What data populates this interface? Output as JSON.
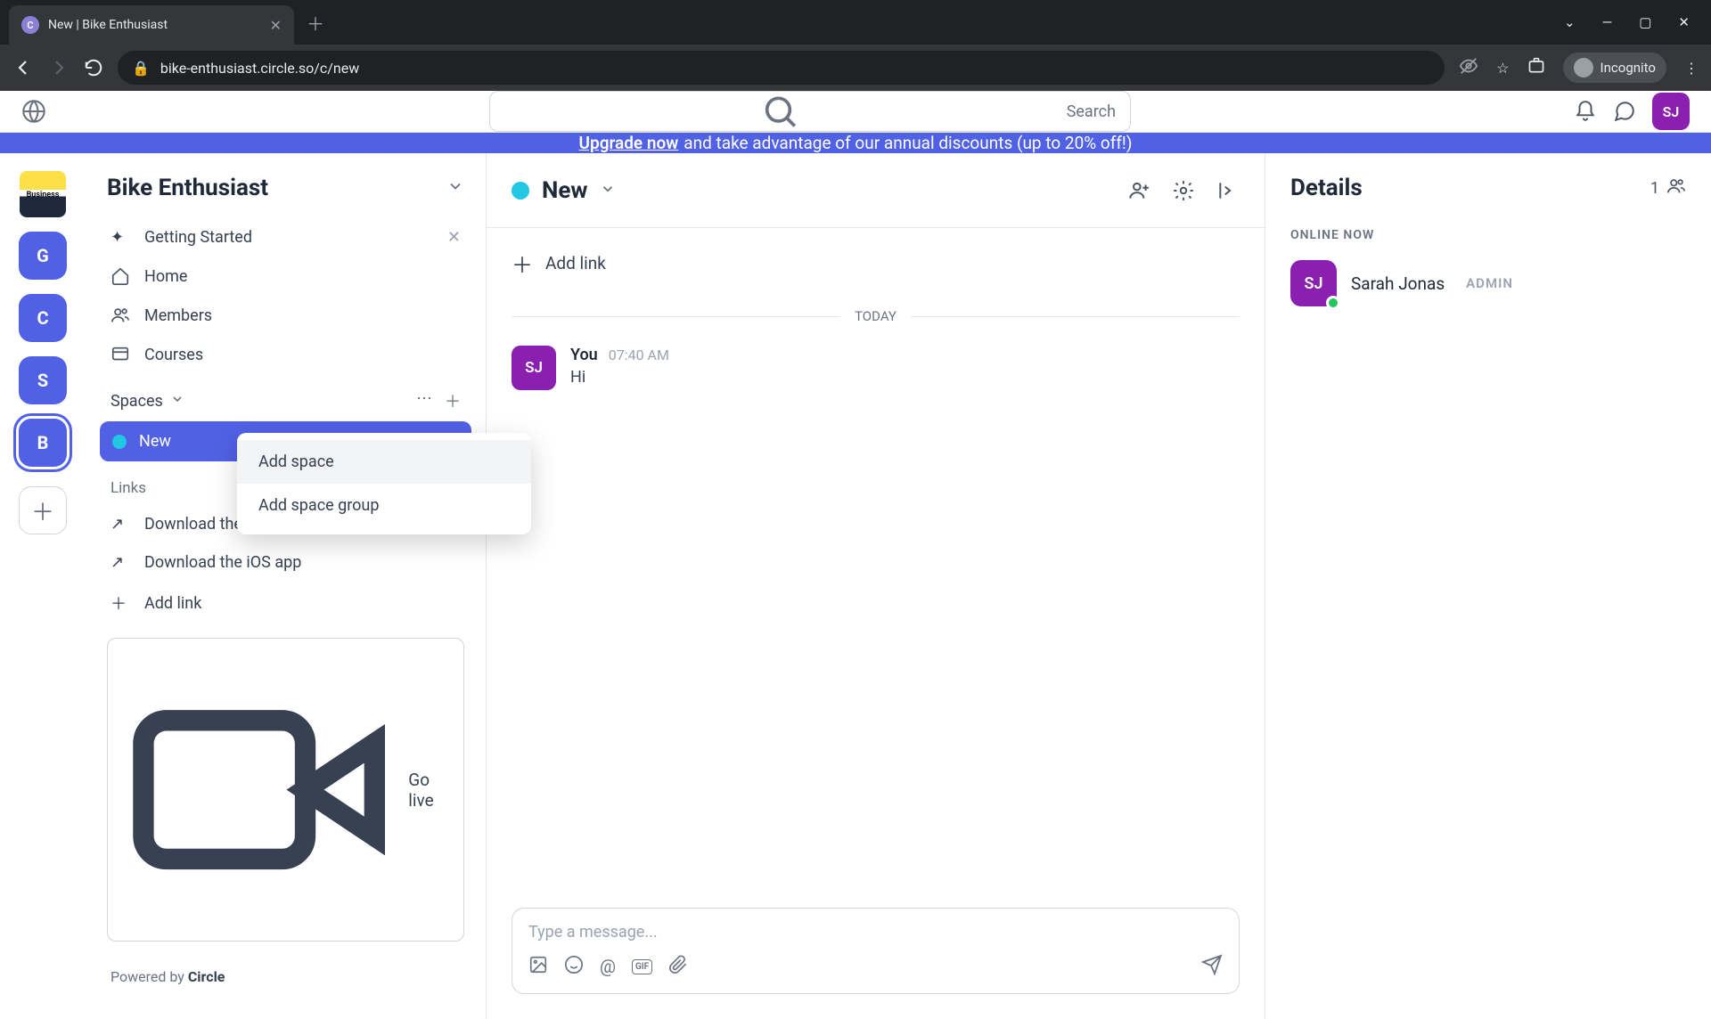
{
  "browser": {
    "tab_title": "New | Bike Enthusiast",
    "url": "bike-enthusiast.circle.so/c/new",
    "incognito_label": "Incognito"
  },
  "topbar": {
    "search_placeholder": "Search",
    "avatar_initials": "SJ"
  },
  "banner": {
    "link_text": "Upgrade now",
    "rest_text": " and take advantage of our annual discounts (up to 20% off!)"
  },
  "rail": {
    "logo_text": "Business",
    "items": [
      "G",
      "C",
      "S",
      "B"
    ],
    "active_index": 3
  },
  "sidebar": {
    "community_name": "Bike Enthusiast",
    "nav": {
      "getting_started": "Getting Started",
      "home": "Home",
      "members": "Members",
      "courses": "Courses"
    },
    "spaces_label": "Spaces",
    "active_space": "New",
    "links_label": "Links",
    "links": {
      "android": "Download the Android app",
      "ios": "Download the iOS app",
      "add": "Add link"
    },
    "golive": "Go live",
    "powered_prefix": "Powered by ",
    "powered_brand": "Circle"
  },
  "dropdown": {
    "add_space": "Add space",
    "add_space_group": "Add space group"
  },
  "center": {
    "title": "New",
    "add_link": "Add link",
    "today_label": "TODAY",
    "message": {
      "avatar": "SJ",
      "author": "You",
      "time": "07:40 AM",
      "text": "Hi"
    },
    "composer_placeholder": "Type a message..."
  },
  "details": {
    "title": "Details",
    "count": "1",
    "online_label": "ONLINE NOW",
    "member": {
      "avatar": "SJ",
      "name": "Sarah Jonas",
      "badge": "ADMIN"
    }
  }
}
